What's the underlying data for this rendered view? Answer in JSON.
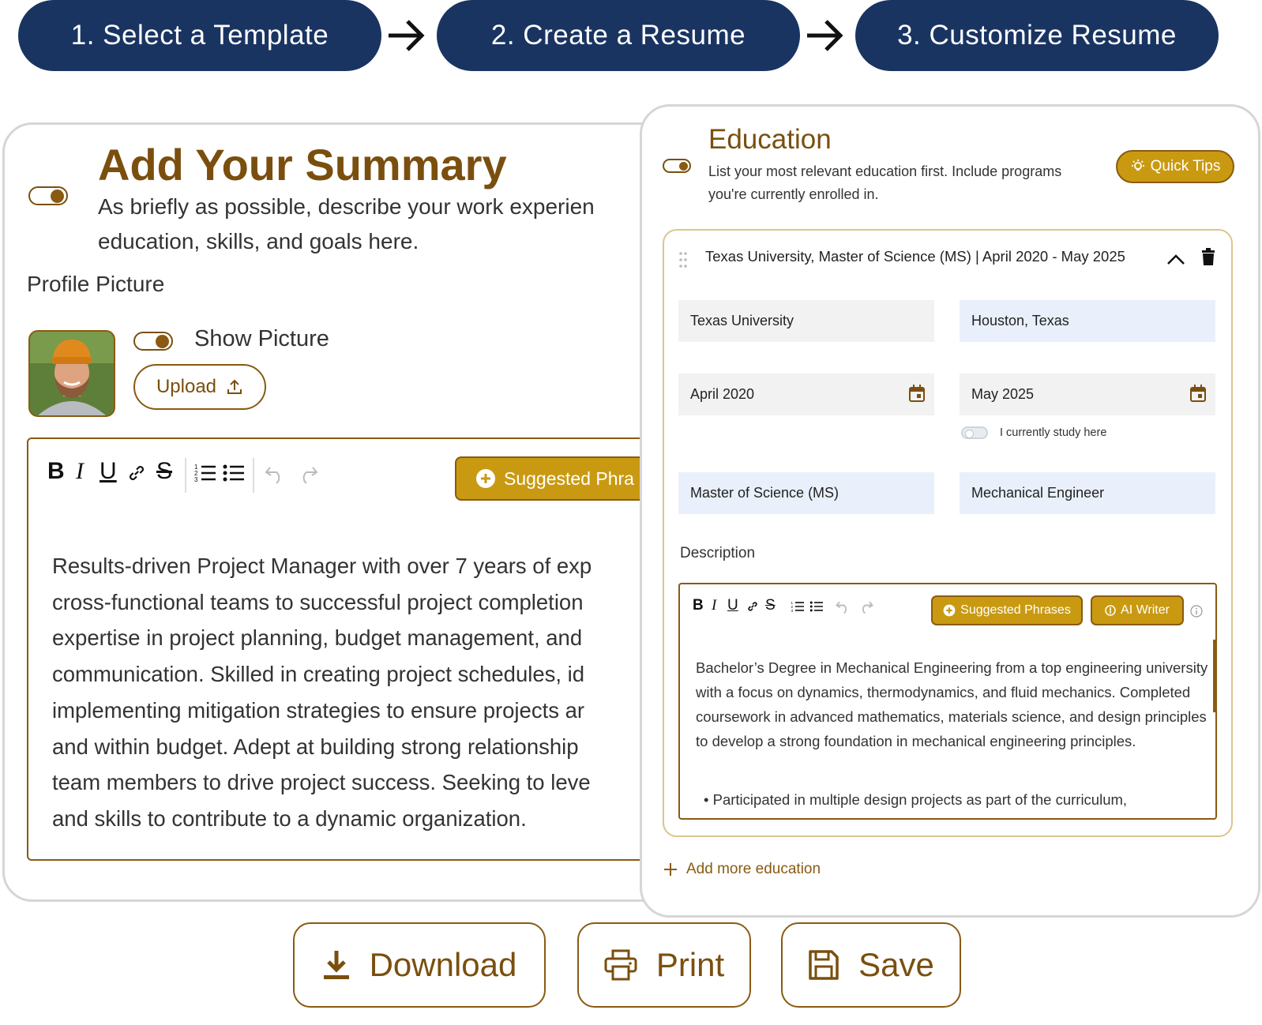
{
  "steps": [
    {
      "label": "1. Select a Template"
    },
    {
      "label": "2. Create a Resume"
    },
    {
      "label": "3. Customize Resume"
    }
  ],
  "summary": {
    "title": "Add Your Summary",
    "description_line1": "As briefly as possible, describe your work experien",
    "description_line2": "education, skills, and goals here.",
    "profile_label": "Profile Picture",
    "show_picture_label": "Show Picture",
    "upload_label": "Upload",
    "suggested_label": "Suggested Phra",
    "text_lines": [
      "Results-driven Project Manager with over 7 years of exp",
      "cross-functional teams to successful project completion",
      "expertise in project planning, budget management, and",
      "communication. Skilled in creating project schedules, id",
      "implementing mitigation strategies to ensure projects ar",
      "and within budget. Adept at building strong relationship",
      "team members to drive project success. Seeking to leve",
      "and skills to contribute to a dynamic organization."
    ]
  },
  "education": {
    "title": "Education",
    "description": "List your most relevant education first. Include programs you're currently enrolled in.",
    "quick_tips": "Quick Tips",
    "entry_header": "Texas University, Master of Science (MS) | April 2020 - May 2025",
    "school": "Texas University",
    "location": "Houston, Texas",
    "start_date": "April 2020",
    "end_date": "May 2025",
    "study_here": "I currently study here",
    "degree": "Master of Science (MS)",
    "field": "Mechanical Engineer",
    "description_label": "Description",
    "suggested_label": "Suggested Phrases",
    "ai_writer_label": "AI Writer",
    "text": "Bachelor’s Degree in Mechanical Engineering from a top engineering university with a focus on dynamics, thermodynamics, and fluid mechanics. Completed coursework in advanced mathematics, materials science, and design principles to develop a strong foundation in mechanical engineering principles.",
    "bullet": "Participated in multiple design projects as part of the curriculum,",
    "add_more": "Add more education"
  },
  "actions": {
    "download": "Download",
    "print": "Print",
    "save": "Save"
  },
  "colors": {
    "navy": "#1a3462",
    "brown": "#7a4f0e",
    "gold": "#c99a11"
  }
}
